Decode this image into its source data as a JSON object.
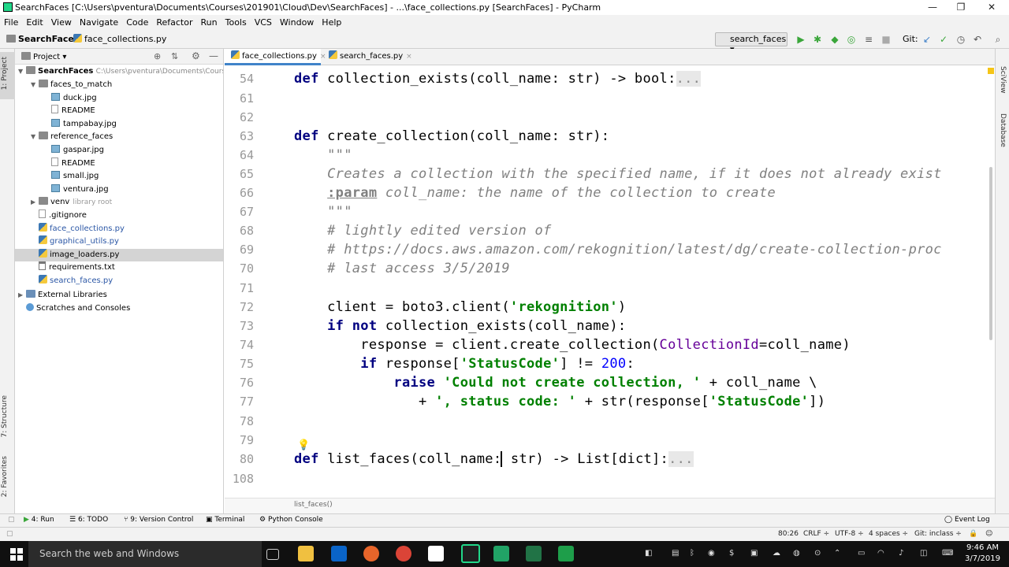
{
  "window": {
    "title": "SearchFaces [C:\\Users\\pventura\\Documents\\Courses\\201901\\Cloud\\Dev\\SearchFaces] - ...\\face_collections.py [SearchFaces] - PyCharm",
    "minimize": "—",
    "restore": "❐",
    "close": "✕"
  },
  "menu": [
    "File",
    "Edit",
    "View",
    "Navigate",
    "Code",
    "Refactor",
    "Run",
    "Tools",
    "VCS",
    "Window",
    "Help"
  ],
  "navbar": {
    "project": "SearchFaces",
    "file": "face_collections.py",
    "run_config": "search_faces",
    "git_label": "Git:"
  },
  "project_panel": {
    "header": "Project",
    "root_name": "SearchFaces",
    "root_path": "C:\\Users\\pventura\\Documents\\Courses",
    "items": [
      {
        "label": "faces_to_match",
        "type": "folder",
        "depth": 1,
        "expanded": true
      },
      {
        "label": "duck.jpg",
        "type": "image",
        "depth": 2
      },
      {
        "label": "README",
        "type": "file",
        "depth": 2
      },
      {
        "label": "tampabay.jpg",
        "type": "image",
        "depth": 2
      },
      {
        "label": "reference_faces",
        "type": "folder",
        "depth": 1,
        "expanded": true
      },
      {
        "label": "gaspar.jpg",
        "type": "image",
        "depth": 2
      },
      {
        "label": "README",
        "type": "file",
        "depth": 2
      },
      {
        "label": "small.jpg",
        "type": "image",
        "depth": 2
      },
      {
        "label": "ventura.jpg",
        "type": "image",
        "depth": 2
      },
      {
        "label": "venv",
        "type": "folder",
        "depth": 1,
        "expanded": false,
        "note": "library root"
      },
      {
        "label": ".gitignore",
        "type": "file",
        "depth": 1
      },
      {
        "label": "face_collections.py",
        "type": "py",
        "depth": 1
      },
      {
        "label": "graphical_utils.py",
        "type": "py",
        "depth": 1
      },
      {
        "label": "image_loaders.py",
        "type": "py",
        "depth": 1,
        "selected": true
      },
      {
        "label": "requirements.txt",
        "type": "txt",
        "depth": 1
      },
      {
        "label": "search_faces.py",
        "type": "py",
        "depth": 1
      }
    ],
    "external_libraries": "External Libraries",
    "scratches": "Scratches and Consoles"
  },
  "left_stripe": {
    "project": "1: Project",
    "structure": "7: Structure",
    "favorites": "2: Favorites"
  },
  "right_stripe": {
    "sciview": "SciView",
    "database": "Database"
  },
  "tabs": [
    {
      "label": "face_collections.py",
      "active": true
    },
    {
      "label": "search_faces.py",
      "active": false
    }
  ],
  "tab_close": "×",
  "line_numbers": [
    "54",
    "61",
    "62",
    "63",
    "64",
    "65",
    "66",
    "67",
    "68",
    "69",
    "70",
    "71",
    "72",
    "73",
    "74",
    "75",
    "76",
    "77",
    "78",
    "79",
    "80",
    "108"
  ],
  "code": {
    "l54": {
      "kw": "def",
      "rest": " collection_exists(coll_name: str) -> bool:",
      "fold": "..."
    },
    "l63": {
      "kw": "def",
      "rest": " create_collection(coll_name: str):"
    },
    "l64": "    \"\"\"",
    "l65": "    Creates a collection with the specified name, if it does not already exist",
    "l66_tag": ":param",
    "l66_rest": " coll_name: the name of the collection to create",
    "l67": "    \"\"\"",
    "l68": "    # lightly edited version of",
    "l69": "    # https://docs.aws.amazon.com/rekognition/latest/dg/create-collection-proc",
    "l70": "    # last access 3/5/2019",
    "l72_a": "    client = boto3.client(",
    "l72_s": "'rekognition'",
    "l72_b": ")",
    "l73_kw1": "if not",
    "l73_rest": " collection_exists(coll_name):",
    "l74_a": "        response = client.create_collection(",
    "l74_p": "CollectionId",
    "l74_b": "=coll_name)",
    "l75_kw": "if",
    "l75_a": " response[",
    "l75_s": "'StatusCode'",
    "l75_b": "] != ",
    "l75_n": "200",
    "l75_c": ":",
    "l76_kw": "raise",
    "l76_s": " 'Could not create collection, '",
    "l76_b": " + coll_name \\",
    "l77_a": "               + ",
    "l77_s1": "', status code: '",
    "l77_b": " + str(response[",
    "l77_s2": "'StatusCode'",
    "l77_c": "])",
    "l80": {
      "kw": "def",
      "rest_a": " list_faces(coll_name:",
      "rest_b": " str) -> List[dict]:",
      "fold": "..."
    }
  },
  "editor_breadcrumb": "list_faces()",
  "tool_windows": [
    {
      "label": "4: Run"
    },
    {
      "label": "6: TODO"
    },
    {
      "label": "9: Version Control"
    },
    {
      "label": "Terminal"
    },
    {
      "label": "Python Console"
    }
  ],
  "event_log": "Event Log",
  "status": {
    "position": "80:26",
    "line_sep": "CRLF ÷",
    "encoding": "UTF-8 ÷",
    "indent": "4 spaces ÷",
    "git_branch": "Git: inclass ÷"
  },
  "taskbar": {
    "search_placeholder": "Search the web and Windows",
    "time": "9:46 AM",
    "date": "3/7/2019"
  },
  "colors": {
    "keyword": "#000080",
    "string": "#008000",
    "comment": "#808080",
    "number": "#0000ff",
    "accent": "#4083c9"
  }
}
